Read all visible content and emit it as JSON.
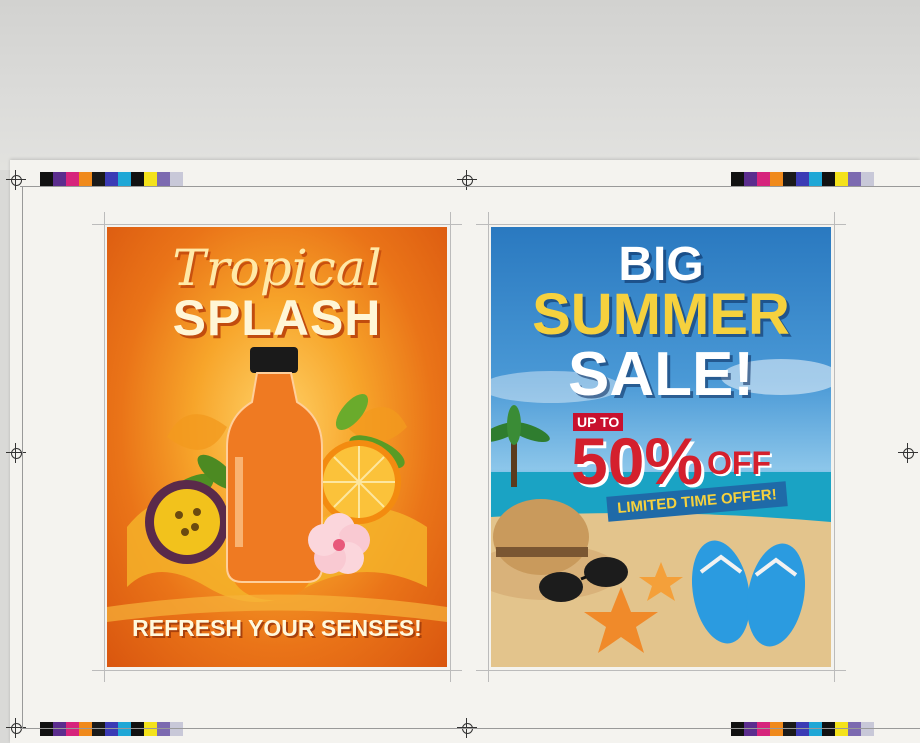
{
  "posters": {
    "left": {
      "title_line1": "Tropical",
      "title_line2": "SPLASH",
      "tagline": "REFRESH YOUR SENSES!"
    },
    "right": {
      "line1": "BIG",
      "line2": "SUMMER",
      "line3": "SALE!",
      "up_to": "UP TO",
      "percent": "50%",
      "off": "OFF",
      "ribbon": "LIMITED TIME OFFER!"
    }
  },
  "colors": {
    "left_background": "#ea7418",
    "right_sky": "#2a79c0",
    "sale_red": "#d4202d",
    "sale_yellow": "#f6d13e"
  },
  "color_bar_swatches": [
    "#111111",
    "#5b2d8e",
    "#d6247c",
    "#f08a1c",
    "#1a1a1a",
    "#3b3bb5",
    "#1fa7d6",
    "#111111",
    "#f4e21c",
    "#7c6ab0",
    "#c8c8d8"
  ],
  "icons": {
    "registration_mark": "registration-mark-icon",
    "bottle": "juice-bottle-icon",
    "sun_hat": "sun-hat-icon",
    "sunglasses": "sunglasses-icon",
    "starfish": "starfish-icon",
    "flip_flops": "flip-flops-icon",
    "palm_tree": "palm-tree-icon"
  }
}
